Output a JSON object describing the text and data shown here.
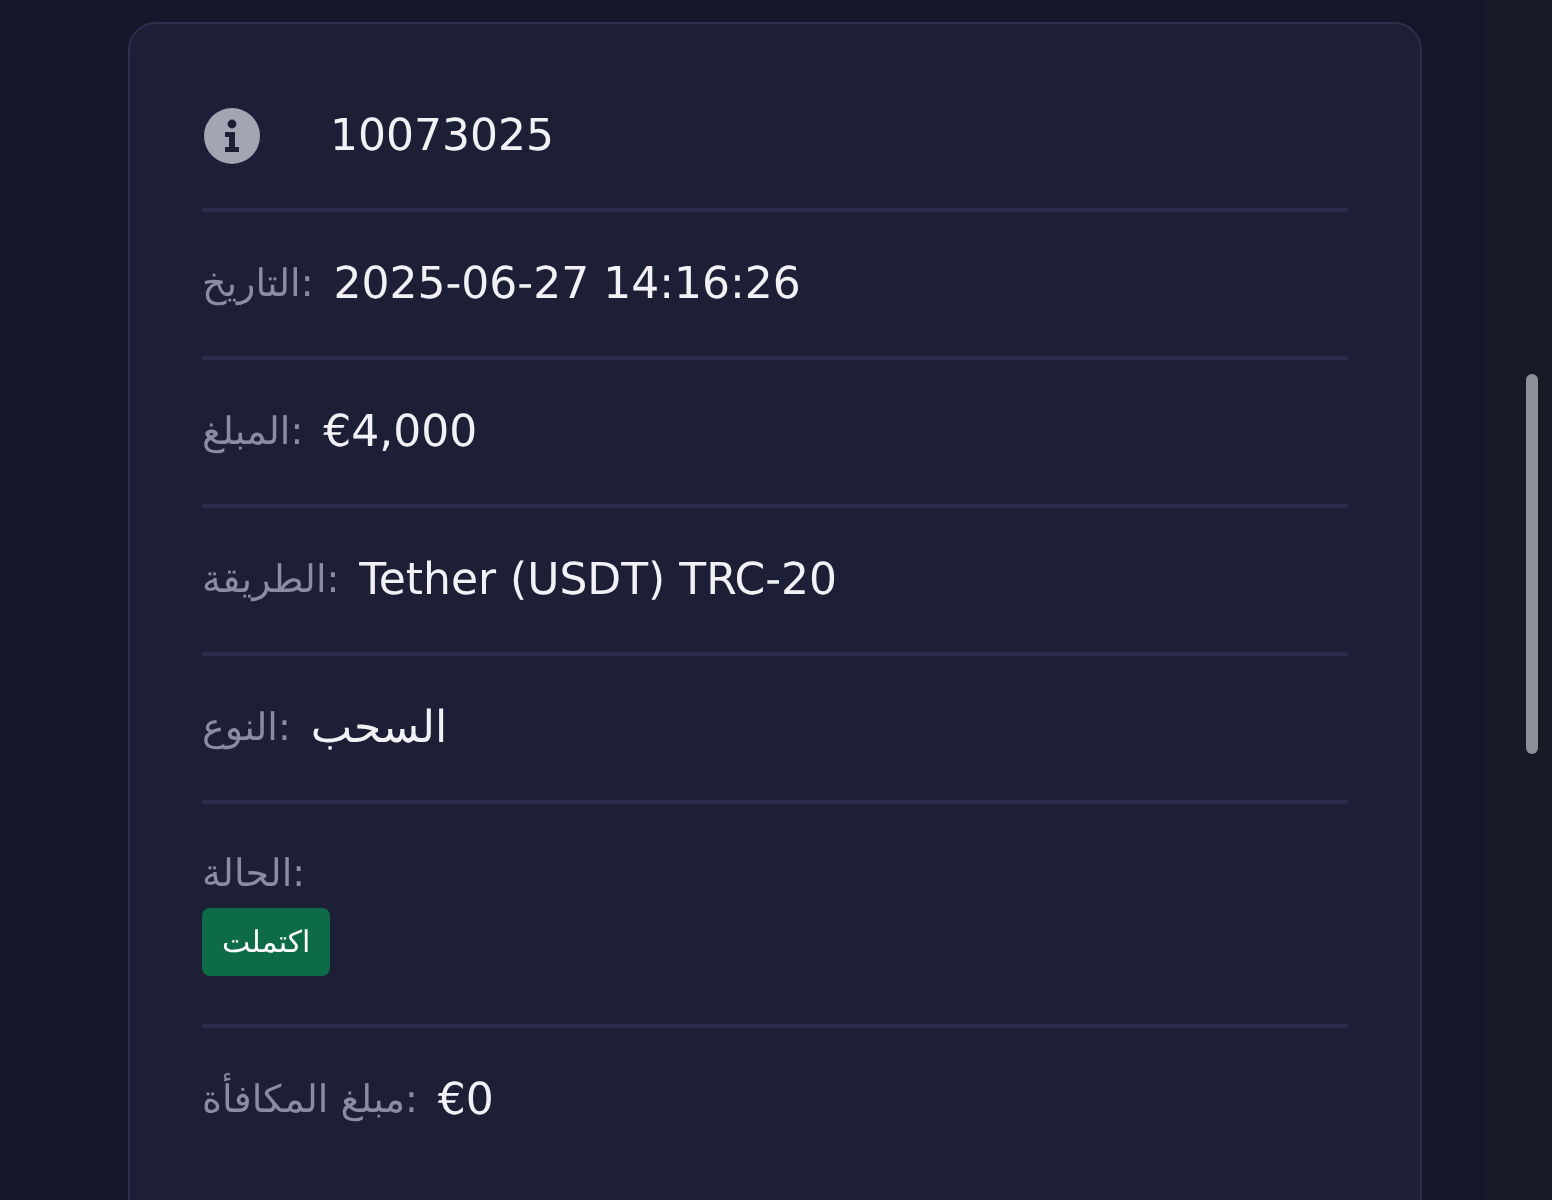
{
  "details": {
    "rows": [
      {
        "kind": "id",
        "value": "10073025"
      },
      {
        "kind": "field",
        "label": "التاريخ:",
        "value": "2025-06-27 14:16:26"
      },
      {
        "kind": "field",
        "label": "المبلغ:",
        "value": "€4,000"
      },
      {
        "kind": "field",
        "label": "الطريقة:",
        "value": "Tether (USDT) TRC-20"
      },
      {
        "kind": "field",
        "label": "النوع:",
        "value": "السحب"
      },
      {
        "kind": "status",
        "label": "الحالة:",
        "badge": "اكتملت",
        "color": "#0e6b47"
      },
      {
        "kind": "field",
        "label": "مبلغ المكافأة:",
        "value": "€0"
      }
    ]
  }
}
